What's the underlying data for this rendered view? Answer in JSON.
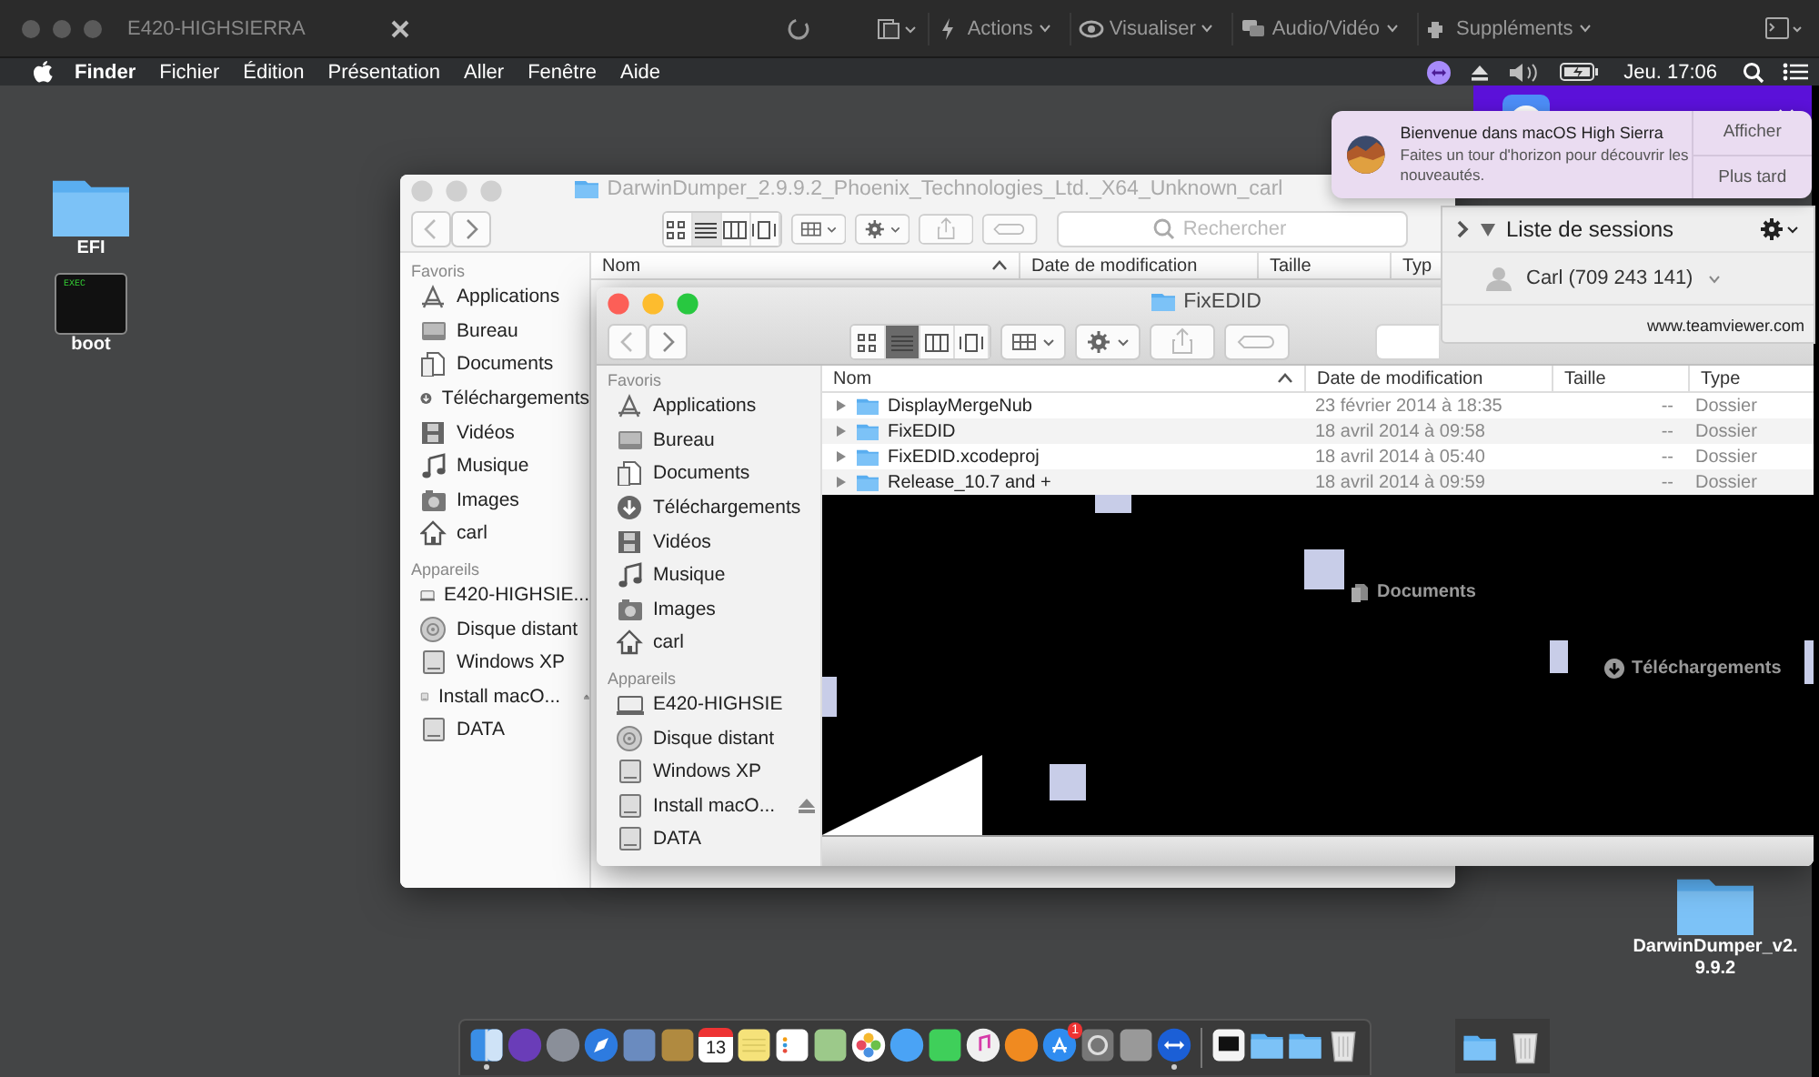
{
  "remote_toolbar": {
    "title": "E420-HIGHSIERRA",
    "menus": [
      {
        "label": "Actions"
      },
      {
        "label": "Visualiser"
      },
      {
        "label": "Audio/Vidéo"
      },
      {
        "label": "Suppléments"
      }
    ]
  },
  "menu_bar": {
    "app": "Finder",
    "items": [
      "Fichier",
      "Édition",
      "Présentation",
      "Aller",
      "Fenêtre",
      "Aide"
    ],
    "clock": "Jeu. 17:06"
  },
  "desktop_icons": [
    {
      "kind": "folder",
      "label": "EFI"
    },
    {
      "kind": "exec",
      "badge": "EXEC",
      "label": "boot"
    }
  ],
  "desktop_folder": {
    "lines": [
      "DarwinDumper_v2.",
      "9.9.2"
    ]
  },
  "back_finder": {
    "title": "DarwinDumper_2.9.9.2_Phoenix_Technologies_Ltd._X64_Unknown_carl",
    "search": {
      "placeholder": "Rechercher"
    },
    "view_modes": [
      {
        "kind": "icons",
        "selected": false
      },
      {
        "kind": "list",
        "selected": true
      },
      {
        "kind": "columns",
        "selected": false
      },
      {
        "kind": "cover",
        "selected": false
      }
    ],
    "sidebar": [
      {
        "heading": "Favoris",
        "items": [
          {
            "kind": "apps",
            "label": "Applications"
          },
          {
            "kind": "desktop",
            "label": "Bureau"
          },
          {
            "kind": "docs",
            "label": "Documents"
          },
          {
            "kind": "download",
            "label": "Téléchargements"
          },
          {
            "kind": "video",
            "label": "Vidéos"
          },
          {
            "kind": "music",
            "label": "Musique"
          },
          {
            "kind": "images",
            "label": "Images"
          },
          {
            "kind": "home",
            "label": "carl"
          }
        ]
      },
      {
        "heading": "Appareils",
        "items": [
          {
            "kind": "computer",
            "label": "E420-HIGHSIE..."
          },
          {
            "kind": "disk",
            "label": "Disque distant"
          },
          {
            "kind": "drive",
            "label": "Windows XP"
          },
          {
            "kind": "drive",
            "label": "Install macO...",
            "eject": true
          },
          {
            "kind": "drive",
            "label": "DATA"
          }
        ]
      }
    ],
    "columns": [
      {
        "label": "Nom",
        "sorted": true
      },
      {
        "label": "Date de modification",
        "sorted": false
      },
      {
        "label": "Taille",
        "sorted": false
      },
      {
        "label": "Typ",
        "sorted": false
      }
    ]
  },
  "front_finder": {
    "title": "FixEDID",
    "view_modes": [
      {
        "kind": "icons",
        "selected": false
      },
      {
        "kind": "list",
        "selected": true
      },
      {
        "kind": "columns",
        "selected": false
      },
      {
        "kind": "cover",
        "selected": false
      }
    ],
    "sidebar": [
      {
        "heading": "Favoris",
        "items": [
          {
            "kind": "apps",
            "label": "Applications"
          },
          {
            "kind": "desktop",
            "label": "Bureau"
          },
          {
            "kind": "docs",
            "label": "Documents"
          },
          {
            "kind": "download",
            "label": "Téléchargements"
          },
          {
            "kind": "video",
            "label": "Vidéos"
          },
          {
            "kind": "music",
            "label": "Musique"
          },
          {
            "kind": "images",
            "label": "Images"
          },
          {
            "kind": "home",
            "label": "carl"
          }
        ]
      },
      {
        "heading": "Appareils",
        "items": [
          {
            "kind": "computer",
            "label": "E420-HIGHSIE"
          },
          {
            "kind": "disk",
            "label": "Disque distant"
          },
          {
            "kind": "drive",
            "label": "Windows XP"
          },
          {
            "kind": "drive",
            "label": "Install macO...",
            "eject": true
          },
          {
            "kind": "drive",
            "label": "DATA"
          }
        ]
      }
    ],
    "columns": [
      {
        "label": "Nom",
        "sorted": true
      },
      {
        "label": "Date de modification",
        "sorted": false
      },
      {
        "label": "Taille",
        "sorted": false
      },
      {
        "label": "Type",
        "sorted": false
      }
    ],
    "rows": [
      {
        "name": "DisplayMergeNub",
        "date": "23 février 2014 à 18:35",
        "size": "--",
        "type": "Dossier"
      },
      {
        "name": "FixEDID",
        "date": "18 avril 2014 à 09:58",
        "size": "--",
        "type": "Dossier"
      },
      {
        "name": "FixEDID.xcodeproj",
        "date": "18 avril 2014 à 05:40",
        "size": "--",
        "type": "Dossier"
      },
      {
        "name": "Release_10.7 and +",
        "date": "18 avril 2014 à 09:59",
        "size": "--",
        "type": "Dossier"
      }
    ],
    "glitch_texts": [
      "Documents",
      "Téléchargements"
    ]
  },
  "notification": {
    "title": "Bienvenue dans macOS High Sierra",
    "body": "Faites un tour d'horizon pour découvrir les nouveautés.",
    "actions": [
      "Afficher",
      "Plus tard"
    ]
  },
  "teamviewer": {
    "title": "Liste de sessions",
    "session": "Carl (709 243 141)",
    "footer": "www.teamviewer.com"
  },
  "dock": {
    "items": [
      {
        "kind": "finder",
        "running": true
      },
      {
        "kind": "siri",
        "running": false
      },
      {
        "kind": "launchpad",
        "running": false
      },
      {
        "kind": "safari",
        "running": false
      },
      {
        "kind": "preview",
        "running": false
      },
      {
        "kind": "contacts",
        "running": false
      },
      {
        "kind": "calendar",
        "label": "13",
        "running": false
      },
      {
        "kind": "notes",
        "running": false
      },
      {
        "kind": "reminders",
        "running": false
      },
      {
        "kind": "maps",
        "running": false
      },
      {
        "kind": "photos",
        "running": false
      },
      {
        "kind": "messages",
        "running": false
      },
      {
        "kind": "facetime",
        "running": false
      },
      {
        "kind": "itunes",
        "running": false
      },
      {
        "kind": "ibooks",
        "running": false
      },
      {
        "kind": "appstore",
        "badge": "1",
        "running": false
      },
      {
        "kind": "prefs",
        "running": false
      },
      {
        "kind": "utility",
        "running": false
      },
      {
        "kind": "teamviewer",
        "running": true
      },
      {
        "kind": "separator"
      },
      {
        "kind": "exec",
        "running": false
      },
      {
        "kind": "folder",
        "running": false
      },
      {
        "kind": "folder",
        "running": false
      },
      {
        "kind": "trash",
        "running": false
      }
    ],
    "extra": [
      {
        "kind": "folder"
      },
      {
        "kind": "trash"
      }
    ]
  }
}
